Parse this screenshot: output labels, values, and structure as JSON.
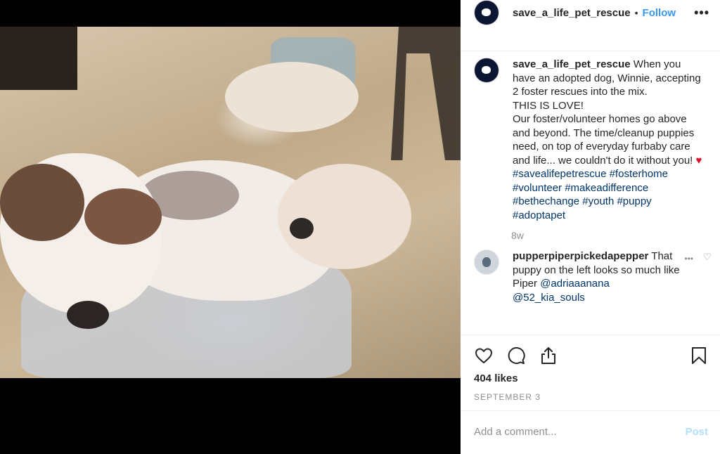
{
  "header": {
    "username": "save_a_life_pet_rescue",
    "separator": "•",
    "follow_label": "Follow",
    "more_label": "•••"
  },
  "caption": {
    "username": "save_a_life_pet_rescue",
    "text_line1": "When you have an adopted dog, Winnie, accepting 2 foster rescues into the mix.",
    "text_line2": "THIS IS LOVE!",
    "text_line3": "Our foster/volunteer homes go above and beyond. The time/cleanup puppies need, on top of everyday furbaby care and life... we couldn't do it without you!",
    "emoji": "♥",
    "hashtags": "#savealifepetrescue #fosterhome #volunteer #makeadifference #bethechange #youth #puppy #adoptapet",
    "age": "8w"
  },
  "comment": {
    "username": "pupperpiperpickedapepper",
    "text": "That puppy on the left looks so much like Piper",
    "mention1": "@adriaaanana",
    "mention2": "@52_kia_souls",
    "more_label": "•••",
    "like_icon": "♡"
  },
  "post_meta": {
    "likes": "404 likes",
    "date": "SEPTEMBER 3"
  },
  "compose": {
    "placeholder": "Add a comment...",
    "post_label": "Post"
  },
  "icons": {
    "like": "heart-outline-icon",
    "comment": "speech-bubble-icon",
    "share": "share-icon",
    "save": "bookmark-icon"
  },
  "colors": {
    "link": "#3897f0",
    "hashtag": "#003569",
    "muted": "#8e8e8e",
    "post_disabled": "#b2dffc"
  }
}
